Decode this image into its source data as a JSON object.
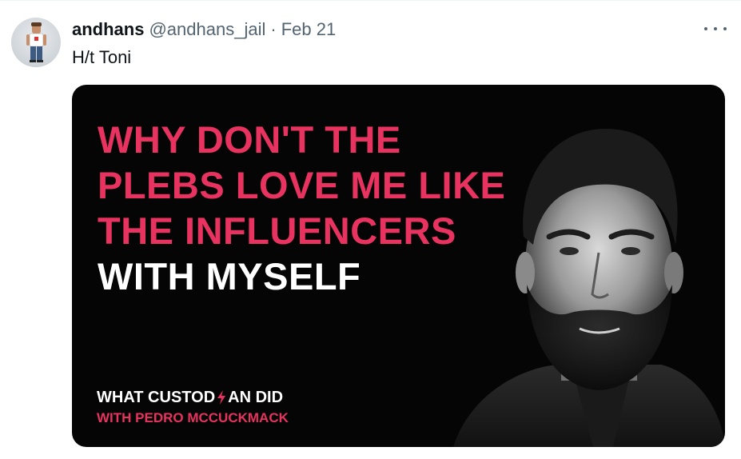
{
  "tweet": {
    "display_name": "andhans",
    "handle": "@andhans_jail",
    "separator": "·",
    "date": "Feb 21",
    "text": "H/t Toni",
    "more_icon": "more-horizontal-icon",
    "avatar_icon": "avatar-figure"
  },
  "media": {
    "headline_lines": [
      "WHY DON'T THE",
      "PLEBS LOVE ME LIKE",
      "THE INFLUENCERS"
    ],
    "subline": "WITH MYSELF",
    "brand_part1": "WHAT CUSTOD",
    "brand_part2": "AN DID",
    "brand_icon": "lightning-bolt-icon",
    "brand_sub": "WITH PEDRO MCCUCKMACK",
    "colors": {
      "accent": "#e8325f",
      "background": "#050505",
      "text": "#ffffff"
    }
  }
}
